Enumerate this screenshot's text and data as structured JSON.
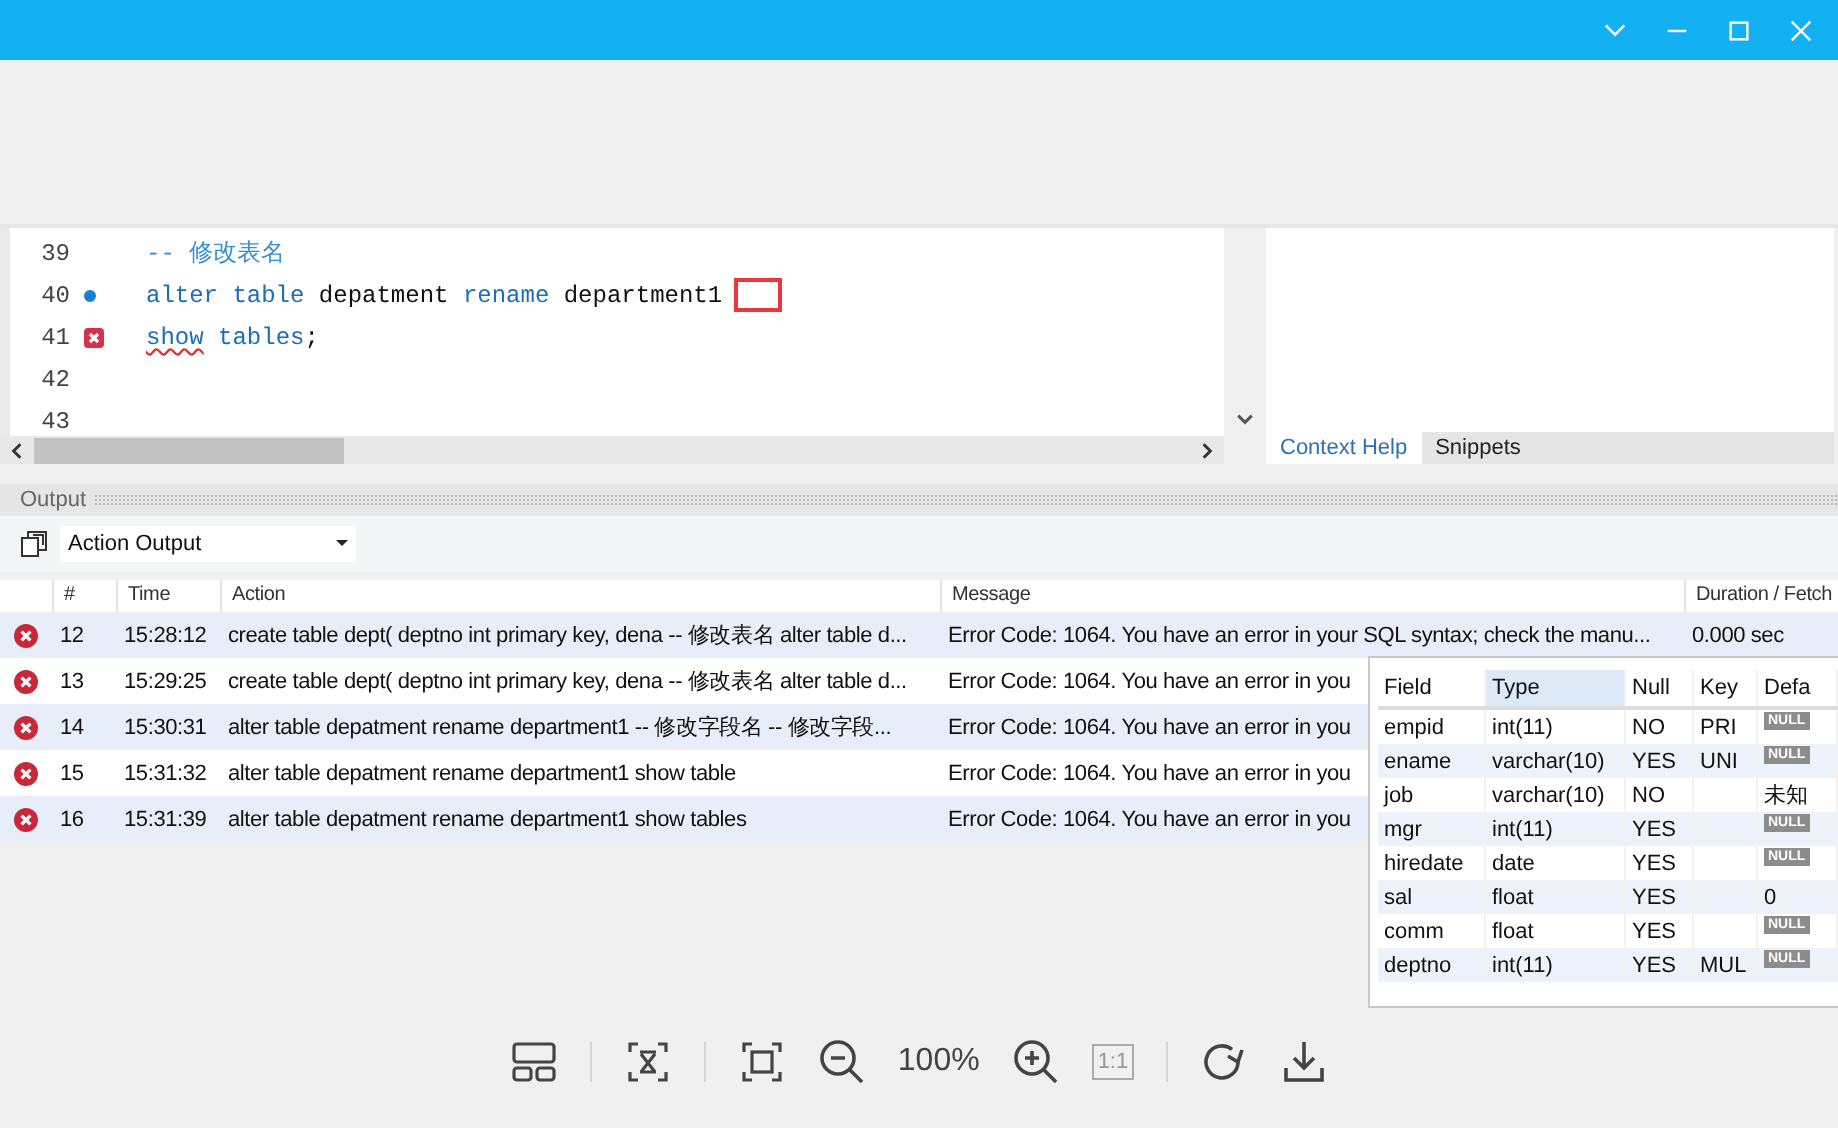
{
  "editor": {
    "lines": [
      {
        "number": "39",
        "dot": false,
        "error_mark": false,
        "boxed": false,
        "tokens": [
          {
            "text": "-- 修改表名",
            "kind": "comment",
            "error": false
          }
        ]
      },
      {
        "number": "40",
        "dot": true,
        "error_mark": false,
        "boxed": true,
        "tokens": [
          {
            "text": "alter table ",
            "kind": "keyword",
            "error": false
          },
          {
            "text": "depatment ",
            "kind": "plain",
            "error": false
          },
          {
            "text": "rename ",
            "kind": "keyword",
            "error": false
          },
          {
            "text": "department1",
            "kind": "plain",
            "error": false
          }
        ]
      },
      {
        "number": "41",
        "dot": false,
        "error_mark": true,
        "boxed": false,
        "tokens": [
          {
            "text": "show",
            "kind": "keyword",
            "error": true
          },
          {
            "text": " tables",
            "kind": "keyword",
            "error": false
          },
          {
            "text": ";",
            "kind": "plain",
            "error": false
          }
        ]
      },
      {
        "number": "42",
        "dot": false,
        "error_mark": false,
        "boxed": false
      },
      {
        "number": "43",
        "dot": false,
        "error_mark": false,
        "boxed": false
      }
    ]
  },
  "side_panel": {
    "tabs": [
      {
        "label": "Context Help",
        "selected": true
      },
      {
        "label": "Snippets",
        "selected": false
      }
    ]
  },
  "output": {
    "title": "Output",
    "dropdown": "Action Output",
    "columns": [
      "#",
      "Time",
      "Action",
      "Message",
      "Duration / Fetch"
    ],
    "rows": [
      {
        "failed": true,
        "number": "12",
        "time": "15:28:12",
        "action": "create table dept( deptno int primary key, dena   -- 修改表名 alter table d...",
        "message": "Error Code: 1064. You have an error in your SQL syntax; check the manu...",
        "duration": "0.000 sec"
      },
      {
        "failed": true,
        "number": "13",
        "time": "15:29:25",
        "action": "create table dept( deptno int primary key, dena   -- 修改表名 alter table d...",
        "message": "Error Code: 1064. You have an error in you"
      },
      {
        "failed": true,
        "number": "14",
        "time": "15:30:31",
        "action": "alter table depatment rename department1   -- 修改字段名   -- 修改字段...",
        "message": "Error Code: 1064. You have an error in you"
      },
      {
        "failed": true,
        "number": "15",
        "time": "15:31:32",
        "action": "alter table depatment rename department1 show table",
        "message": "Error Code: 1064. You have an error in you"
      },
      {
        "failed": true,
        "number": "16",
        "time": "15:31:39",
        "action": "alter table depatment rename department1 show tables",
        "message": "Error Code: 1064. You have an error in you"
      }
    ]
  },
  "field_popup": {
    "columns": [
      {
        "label": "Field",
        "selected": false
      },
      {
        "label": "Type",
        "selected": true
      },
      {
        "label": "Null",
        "selected": false
      },
      {
        "label": "Key",
        "selected": false
      },
      {
        "label": "Defa",
        "selected": false
      }
    ],
    "rows": [
      {
        "field": "empid",
        "type": "int(11)",
        "null": "NO",
        "key": "PRI",
        "default": {
          "kind": "badge",
          "text": "NULL"
        }
      },
      {
        "field": "ename",
        "type": "varchar(10)",
        "null": "YES",
        "key": "UNI",
        "default": {
          "kind": "badge",
          "text": "NULL"
        }
      },
      {
        "field": "job",
        "type": "varchar(10)",
        "null": "NO",
        "default": {
          "kind": "plain",
          "text": "未知"
        }
      },
      {
        "field": "mgr",
        "type": "int(11)",
        "null": "YES",
        "default": {
          "kind": "badge",
          "text": "NULL"
        }
      },
      {
        "field": "hiredate",
        "type": "date",
        "null": "YES",
        "default": {
          "kind": "badge",
          "text": "NULL"
        }
      },
      {
        "field": "sal",
        "type": "float",
        "null": "YES",
        "default": {
          "kind": "plain",
          "text": "0"
        }
      },
      {
        "field": "comm",
        "type": "float",
        "null": "YES",
        "default": {
          "kind": "badge",
          "text": "NULL"
        }
      },
      {
        "field": "deptno",
        "type": "int(11)",
        "null": "YES",
        "key": "MUL",
        "default": {
          "kind": "badge",
          "text": "NULL"
        }
      }
    ]
  },
  "viewer_toolbar": {
    "zoom": "100%",
    "actual_size": {
      "label": "1:1",
      "disabled": true
    }
  }
}
